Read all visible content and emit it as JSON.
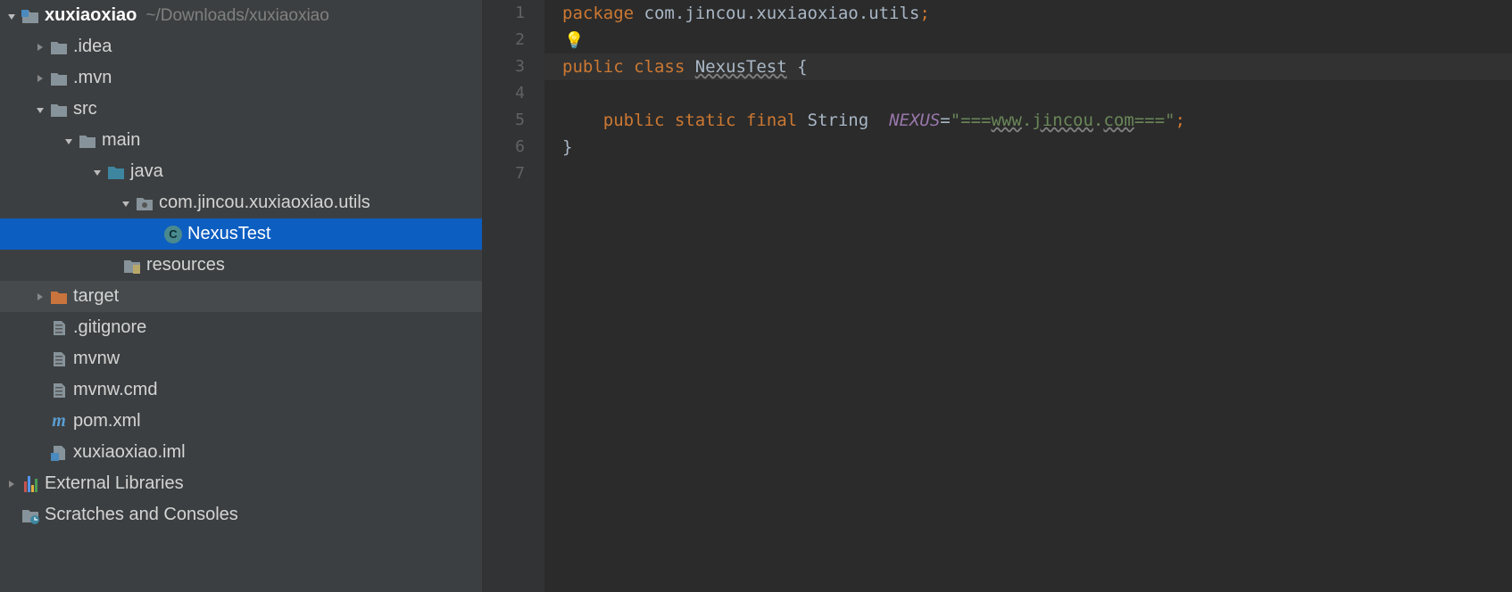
{
  "project": {
    "name": "xuxiaoxiao",
    "path": "~/Downloads/xuxiaoxiao"
  },
  "tree": {
    "idea": ".idea",
    "mvn": ".mvn",
    "src": "src",
    "main": "main",
    "java": "java",
    "pkg": "com.jincou.xuxiaoxiao.utils",
    "nexus": "NexusTest",
    "resources": "resources",
    "target": "target",
    "gitignore": ".gitignore",
    "mvnw": "mvnw",
    "mvnwcmd": "mvnw.cmd",
    "pom": "pom.xml",
    "iml": "xuxiaoxiao.iml",
    "extlib": "External Libraries",
    "scratch": "Scratches and Consoles"
  },
  "gutter": [
    "1",
    "2",
    "3",
    "4",
    "5",
    "6",
    "7"
  ],
  "code": {
    "pkg_kw": "package ",
    "pkg_name": "com.jincou.xuxiaoxiao.utils",
    "cls_kw": "public class ",
    "cls_name": "NexusTest",
    "open": " {",
    "field_decl": "    public static final ",
    "string_type": "String  ",
    "field_name": "NEXUS",
    "eq": "=",
    "str_q1": "\"",
    "str_pre": "===",
    "str_www": "www",
    "str_dot1": ".",
    "str_jincou": "jincou",
    "str_dot2": ".",
    "str_com": "com",
    "str_post": "===",
    "str_q2": "\"",
    "close": "}"
  }
}
